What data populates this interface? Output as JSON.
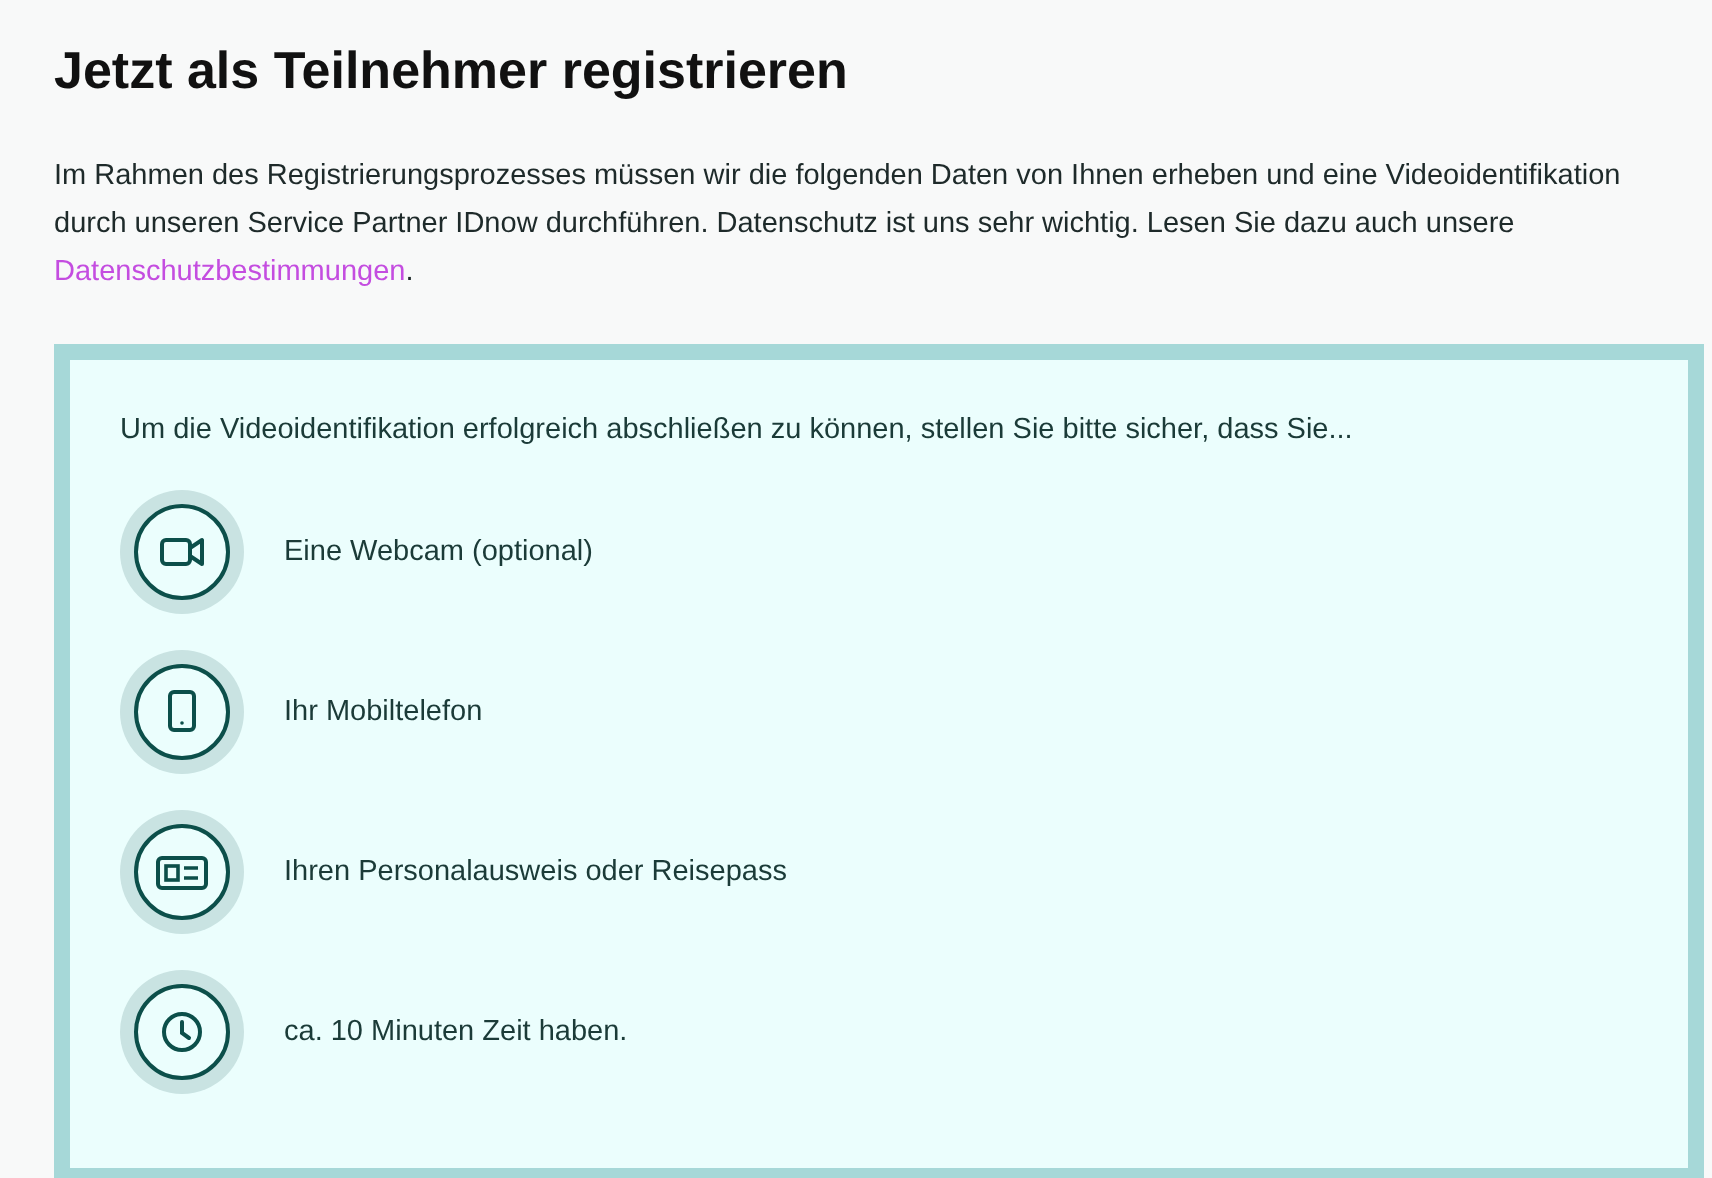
{
  "heading": "Jetzt als Teilnehmer registrieren",
  "intro": {
    "text": "Im Rahmen des Registrierungsprozesses müssen wir die folgenden Daten von Ihnen erheben und eine Videoidentifikation durch unseren Service Partner IDnow durchführen. Datenschutz ist uns sehr wichtig. Lesen Sie dazu auch unsere ",
    "link": "Datenschutzbestimmungen",
    "after": "."
  },
  "checklist": {
    "lead": "Um die Videoidentifikation erfolgreich abschließen zu können, stellen Sie bitte sicher, dass Sie...",
    "items": [
      {
        "kind": "webcam",
        "label": "Eine Webcam (optional)"
      },
      {
        "kind": "phone",
        "label": "Ihr Mobiltelefon"
      },
      {
        "kind": "id_card",
        "label": "Ihren Personalausweis oder Reisepass"
      },
      {
        "kind": "clock",
        "label": "ca. 10 Minuten Zeit haben."
      }
    ]
  }
}
